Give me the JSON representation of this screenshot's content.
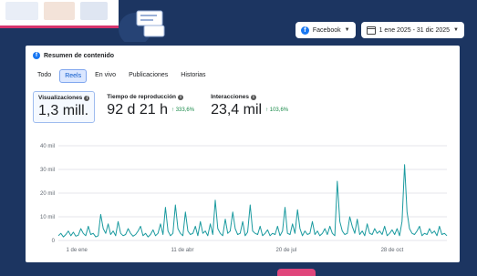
{
  "controls": {
    "platform_label": "Facebook",
    "date_range": "1 ene 2025 - 31 dic 2025"
  },
  "panel": {
    "title": "Resumen de contenido",
    "tabs": [
      {
        "label": "Todo",
        "active": false
      },
      {
        "label": "Reels",
        "active": true
      },
      {
        "label": "En vivo",
        "active": false
      },
      {
        "label": "Publicaciones",
        "active": false
      },
      {
        "label": "Historias",
        "active": false
      }
    ],
    "metrics": [
      {
        "label": "Visualizaciones",
        "value": "1,3 mill.",
        "change": "",
        "active": true
      },
      {
        "label": "Tiempo de reproducción",
        "value": "92 d 21 h",
        "change": "↑ 333,6%",
        "active": false
      },
      {
        "label": "Interacciones",
        "value": "23,4 mil",
        "change": "↑ 103,6%",
        "active": false
      }
    ]
  },
  "chart_data": {
    "type": "line",
    "title": "",
    "xlabel": "",
    "ylabel": "",
    "ylim": [
      0,
      40000
    ],
    "y_ticks": [
      "0",
      "10 mil",
      "20 mil",
      "30 mil",
      "40 mil"
    ],
    "x_ticks": [
      "1 de ene",
      "11 de abr",
      "20 de jul",
      "28 de oct"
    ],
    "grid": true,
    "color": "#1a9a9f",
    "series": [
      {
        "values": [
          2000,
          3000,
          1500,
          2500,
          4000,
          2000,
          3500,
          1800,
          2200,
          5000,
          3000,
          2000,
          6000,
          2500,
          3000,
          1500,
          2000,
          11000,
          5000,
          3000,
          7000,
          2500,
          4000,
          2000,
          8000,
          3000,
          2000,
          2500,
          5000,
          3000,
          1800,
          2500,
          4000,
          6000,
          2000,
          3000,
          1500,
          2500,
          4500,
          2000,
          3000,
          7000,
          2500,
          14000,
          4000,
          2000,
          3000,
          15000,
          5000,
          3000,
          2000,
          12000,
          4000,
          2500,
          3000,
          6000,
          2000,
          8000,
          3000,
          4000,
          2000,
          7000,
          2500,
          17000,
          5000,
          3000,
          2000,
          9000,
          3000,
          4000,
          12000,
          5000,
          2500,
          3000,
          8000,
          2000,
          3500,
          15000,
          4000,
          3000,
          2500,
          6000,
          2000,
          3000,
          4500,
          2000,
          3000,
          2500,
          6000,
          2000,
          4000,
          14000,
          3000,
          2500,
          7000,
          3000,
          13000,
          5000,
          2000,
          4000,
          2500,
          3000,
          8000,
          2500,
          4000,
          2000,
          3000,
          5000,
          2500,
          6000,
          3000,
          2000,
          25000,
          8000,
          4000,
          2500,
          3000,
          10000,
          6000,
          3000,
          9000,
          2500,
          4000,
          2000,
          7000,
          3000,
          2500,
          5000,
          3000,
          4000,
          2500,
          6000,
          2000,
          3000,
          4500,
          2500,
          5000,
          2000,
          8000,
          32000,
          12000,
          5000,
          3000,
          2500,
          4000,
          6000,
          2000,
          3000,
          2500,
          5000,
          3000,
          4000,
          2000,
          6000,
          2500,
          3000,
          2000
        ]
      }
    ]
  }
}
